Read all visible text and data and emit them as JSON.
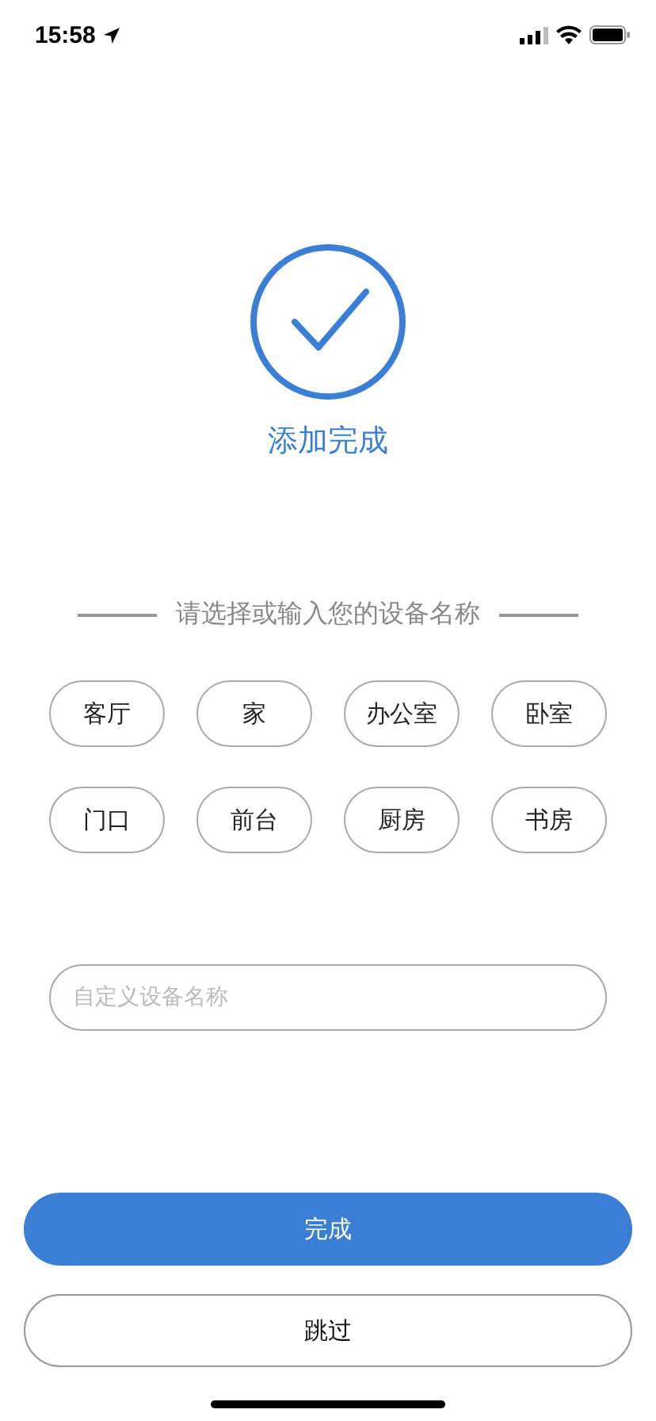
{
  "status_bar": {
    "time": "15:58"
  },
  "result": {
    "title": "添加完成"
  },
  "prompt": "请选择或输入您的设备名称",
  "chips": [
    {
      "label": "客厅",
      "selected": false
    },
    {
      "label": "家",
      "selected": false
    },
    {
      "label": "办公室",
      "selected": false
    },
    {
      "label": "卧室",
      "selected": false
    },
    {
      "label": "门口",
      "selected": false
    },
    {
      "label": "前台",
      "selected": false
    },
    {
      "label": "厨房",
      "selected": false
    },
    {
      "label": "书房",
      "selected": false
    }
  ],
  "name_field": {
    "placeholder": "自定义设备名称"
  },
  "buttons": [
    {
      "label": "完成",
      "kind": "primary"
    },
    {
      "label": "跳过",
      "kind": "secondary"
    }
  ]
}
